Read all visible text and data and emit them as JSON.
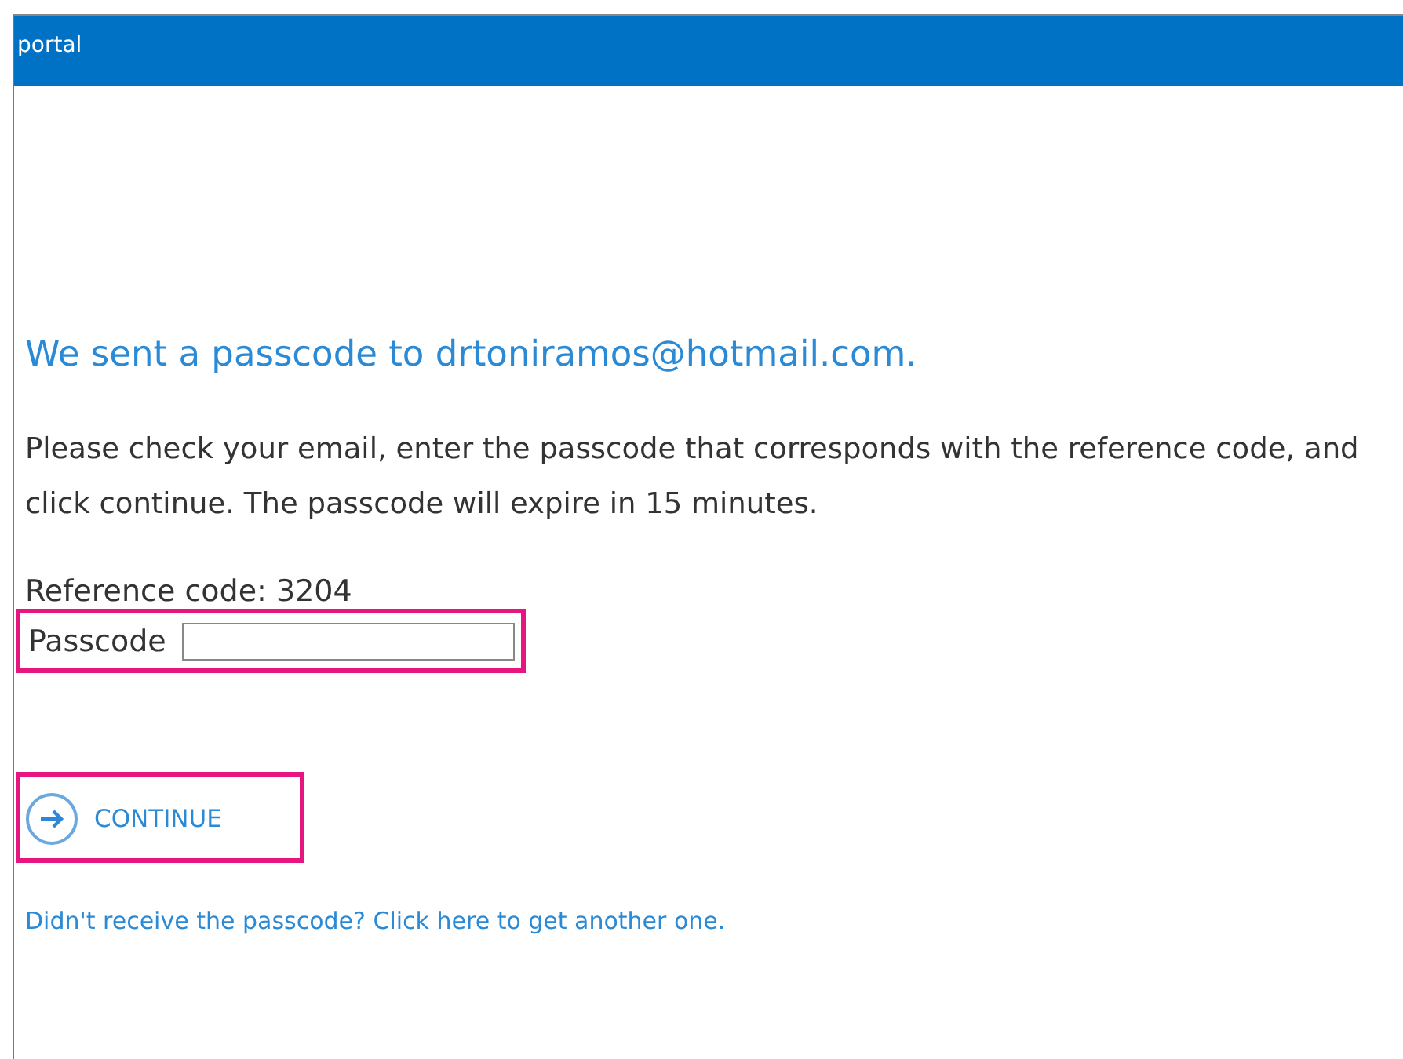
{
  "window": {
    "title": "portal"
  },
  "heading": "We sent a passcode to drtoniramos@hotmail.com.",
  "instructions": "Please check your email, enter the passcode that corresponds with the reference code, and click continue. The passcode will expire in 15 minutes.",
  "reference_code": "Reference code: 3204",
  "passcode_field": {
    "label": "Passcode",
    "highlighted": true
  },
  "continue_button": {
    "label": "CONTINUE",
    "highlighted": true
  },
  "resend_link": "Didn't receive the passcode? Click here to get another one."
}
